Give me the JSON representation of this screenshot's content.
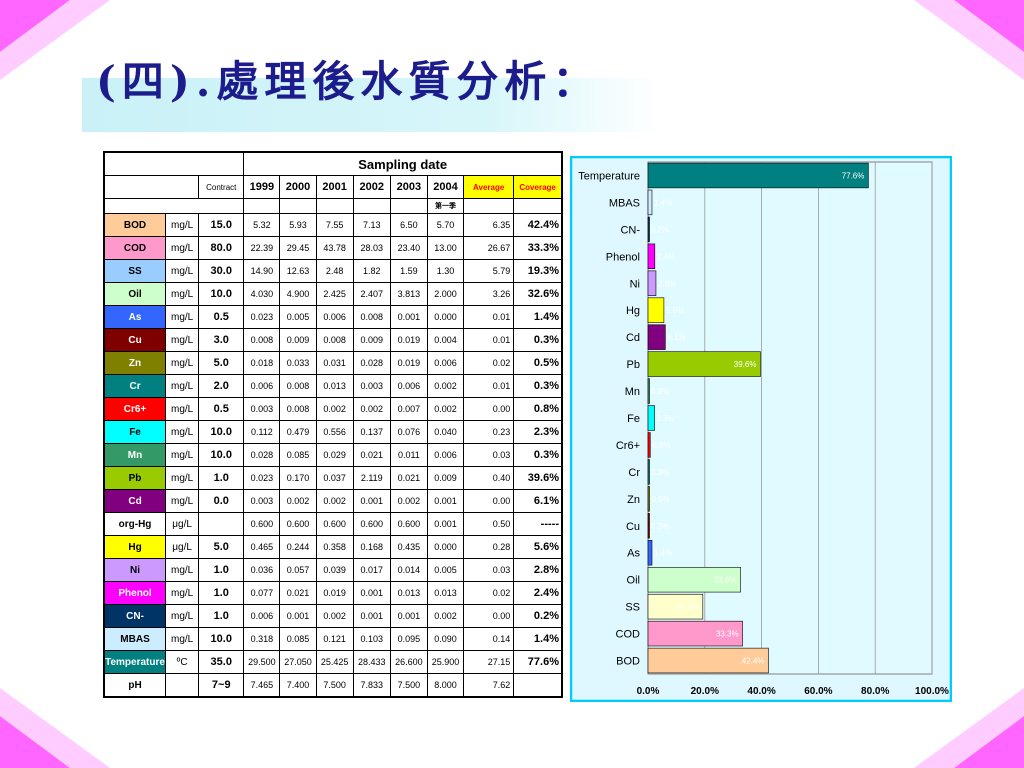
{
  "page": {
    "title": "(四).處理後水質分析："
  },
  "table": {
    "header_sampling": "Sampling date",
    "header_contract": "Contract",
    "years": [
      "1999",
      "2000",
      "2001",
      "2002",
      "2003",
      "2004"
    ],
    "header_average": "Average",
    "header_coverage": "Coverage",
    "season_note": "第一季",
    "rows": [
      {
        "param": "BOD",
        "unit": "mg/L",
        "limit": "15.0",
        "v": [
          "5.32",
          "5.93",
          "7.55",
          "7.13",
          "6.50",
          "5.70"
        ],
        "avg": "6.35",
        "cov": "42.4%",
        "bg": "#ffcc99",
        "fg": "#000000"
      },
      {
        "param": "COD",
        "unit": "mg/L",
        "limit": "80.0",
        "v": [
          "22.39",
          "29.45",
          "43.78",
          "28.03",
          "23.40",
          "13.00"
        ],
        "avg": "26.67",
        "cov": "33.3%",
        "bg": "#ff99cc",
        "fg": "#000000"
      },
      {
        "param": "SS",
        "unit": "mg/L",
        "limit": "30.0",
        "v": [
          "14.90",
          "12.63",
          "2.48",
          "1.82",
          "1.59",
          "1.30"
        ],
        "avg": "5.79",
        "cov": "19.3%",
        "bg": "#99ccff",
        "fg": "#000000"
      },
      {
        "param": "Oil",
        "unit": "mg/L",
        "limit": "10.0",
        "v": [
          "4.030",
          "4.900",
          "2.425",
          "2.407",
          "3.813",
          "2.000"
        ],
        "avg": "3.26",
        "cov": "32.6%",
        "bg": "#ccffcc",
        "fg": "#000000"
      },
      {
        "param": "As",
        "unit": "mg/L",
        "limit": "0.5",
        "v": [
          "0.023",
          "0.005",
          "0.006",
          "0.008",
          "0.001",
          "0.000"
        ],
        "avg": "0.01",
        "cov": "1.4%",
        "bg": "#3366ff",
        "fg": "#ffffff"
      },
      {
        "param": "Cu",
        "unit": "mg/L",
        "limit": "3.0",
        "v": [
          "0.008",
          "0.009",
          "0.008",
          "0.009",
          "0.019",
          "0.004"
        ],
        "avg": "0.01",
        "cov": "0.3%",
        "bg": "#800000",
        "fg": "#ffffff"
      },
      {
        "param": "Zn",
        "unit": "mg/L",
        "limit": "5.0",
        "v": [
          "0.018",
          "0.033",
          "0.031",
          "0.028",
          "0.019",
          "0.006"
        ],
        "avg": "0.02",
        "cov": "0.5%",
        "bg": "#808000",
        "fg": "#ffffff"
      },
      {
        "param": "Cr",
        "unit": "mg/L",
        "limit": "2.0",
        "v": [
          "0.006",
          "0.008",
          "0.013",
          "0.003",
          "0.006",
          "0.002"
        ],
        "avg": "0.01",
        "cov": "0.3%",
        "bg": "#008080",
        "fg": "#ffffff"
      },
      {
        "param": "Cr6+",
        "unit": "mg/L",
        "limit": "0.5",
        "v": [
          "0.003",
          "0.008",
          "0.002",
          "0.002",
          "0.007",
          "0.002"
        ],
        "avg": "0.00",
        "cov": "0.8%",
        "bg": "#ff0000",
        "fg": "#ffffff"
      },
      {
        "param": "Fe",
        "unit": "mg/L",
        "limit": "10.0",
        "v": [
          "0.112",
          "0.479",
          "0.556",
          "0.137",
          "0.076",
          "0.040"
        ],
        "avg": "0.23",
        "cov": "2.3%",
        "bg": "#00ffff",
        "fg": "#000000"
      },
      {
        "param": "Mn",
        "unit": "mg/L",
        "limit": "10.0",
        "v": [
          "0.028",
          "0.085",
          "0.029",
          "0.021",
          "0.011",
          "0.006"
        ],
        "avg": "0.03",
        "cov": "0.3%",
        "bg": "#339966",
        "fg": "#ffffff"
      },
      {
        "param": "Pb",
        "unit": "mg/L",
        "limit": "1.0",
        "v": [
          "0.023",
          "0.170",
          "0.037",
          "2.119",
          "0.021",
          "0.009"
        ],
        "avg": "0.40",
        "cov": "39.6%",
        "bg": "#99cc00",
        "fg": "#000000"
      },
      {
        "param": "Cd",
        "unit": "mg/L",
        "limit": "0.0",
        "v": [
          "0.003",
          "0.002",
          "0.002",
          "0.001",
          "0.002",
          "0.001"
        ],
        "avg": "0.00",
        "cov": "6.1%",
        "bg": "#800080",
        "fg": "#ffffff"
      },
      {
        "param": "org-Hg",
        "unit": "μg/L",
        "limit": "",
        "v": [
          "0.600",
          "0.600",
          "0.600",
          "0.600",
          "0.600",
          "0.001"
        ],
        "avg": "0.50",
        "cov": "-----",
        "bg": "#ffffff",
        "fg": "#000000"
      },
      {
        "param": "Hg",
        "unit": "μg/L",
        "limit": "5.0",
        "v": [
          "0.465",
          "0.244",
          "0.358",
          "0.168",
          "0.435",
          "0.000"
        ],
        "avg": "0.28",
        "cov": "5.6%",
        "bg": "#ffff00",
        "fg": "#000000"
      },
      {
        "param": "Ni",
        "unit": "mg/L",
        "limit": "1.0",
        "v": [
          "0.036",
          "0.057",
          "0.039",
          "0.017",
          "0.014",
          "0.005"
        ],
        "avg": "0.03",
        "cov": "2.8%",
        "bg": "#cc99ff",
        "fg": "#000000"
      },
      {
        "param": "Phenol",
        "unit": "mg/L",
        "limit": "1.0",
        "v": [
          "0.077",
          "0.021",
          "0.019",
          "0.001",
          "0.013",
          "0.013"
        ],
        "avg": "0.02",
        "cov": "2.4%",
        "bg": "#ff00ff",
        "fg": "#ffffff"
      },
      {
        "param": "CN-",
        "unit": "mg/L",
        "limit": "1.0",
        "v": [
          "0.006",
          "0.001",
          "0.002",
          "0.001",
          "0.001",
          "0.002"
        ],
        "avg": "0.00",
        "cov": "0.2%",
        "bg": "#003366",
        "fg": "#ffffff"
      },
      {
        "param": "MBAS",
        "unit": "mg/L",
        "limit": "10.0",
        "v": [
          "0.318",
          "0.085",
          "0.121",
          "0.103",
          "0.095",
          "0.090"
        ],
        "avg": "0.14",
        "cov": "1.4%",
        "bg": "#ccecff",
        "fg": "#000000"
      },
      {
        "param": "Temperature",
        "unit": "ºC",
        "limit": "35.0",
        "v": [
          "29.500",
          "27.050",
          "25.425",
          "28.433",
          "26.600",
          "25.900"
        ],
        "avg": "27.15",
        "cov": "77.6%",
        "bg": "#008080",
        "fg": "#ffffff"
      },
      {
        "param": "pH",
        "unit": "",
        "limit": "7~9",
        "v": [
          "7.465",
          "7.400",
          "7.500",
          "7.833",
          "7.500",
          "8.000"
        ],
        "avg": "7.62",
        "cov": "",
        "bg": "#ffffff",
        "fg": "#000000"
      }
    ]
  },
  "colors": {
    "title": "#1c1c8c",
    "average_header": "#ffff00",
    "average_text": "#ff0000",
    "coverage_header": "#ffff00",
    "chart_frame": "#00ccff",
    "plot_bg": "#e0fbff"
  },
  "chart_data": {
    "type": "bar",
    "orientation": "horizontal",
    "categories": [
      "Temperature",
      "MBAS",
      "CN-",
      "Phenol",
      "Ni",
      "Hg",
      "Cd",
      "Pb",
      "Mn",
      "Fe",
      "Cr6+",
      "Cr",
      "Zn",
      "Cu",
      "As",
      "Oil",
      "SS",
      "COD",
      "BOD"
    ],
    "values": [
      77.6,
      1.4,
      0.2,
      2.4,
      2.8,
      5.6,
      6.1,
      39.6,
      0.3,
      2.3,
      0.8,
      0.3,
      0.5,
      0.3,
      1.4,
      32.6,
      19.3,
      33.3,
      42.4
    ],
    "value_labels": [
      "77.6%",
      "1.4%",
      "0.2%",
      "2.4%",
      "2.8%",
      "5.6%",
      "6.1%",
      "39.6%",
      "0.3%",
      "2.3%",
      "0.8%",
      "0.3%",
      "0.5%",
      "0.3%",
      "1.4%",
      "32.6%",
      "19.3%",
      "33.3%",
      "42.4%"
    ],
    "colors": [
      "#008080",
      "#ccecff",
      "#003366",
      "#ff00ff",
      "#cc99ff",
      "#ffff00",
      "#800080",
      "#99cc00",
      "#339966",
      "#00ffff",
      "#ff0000",
      "#008080",
      "#808000",
      "#800000",
      "#3366ff",
      "#ccffcc",
      "#ffffcc",
      "#ff99cc",
      "#ffcc99"
    ],
    "xlim": [
      0,
      100
    ],
    "xticks": [
      "0.0%",
      "20.0%",
      "40.0%",
      "60.0%",
      "80.0%",
      "100.0%"
    ],
    "grid": true
  }
}
